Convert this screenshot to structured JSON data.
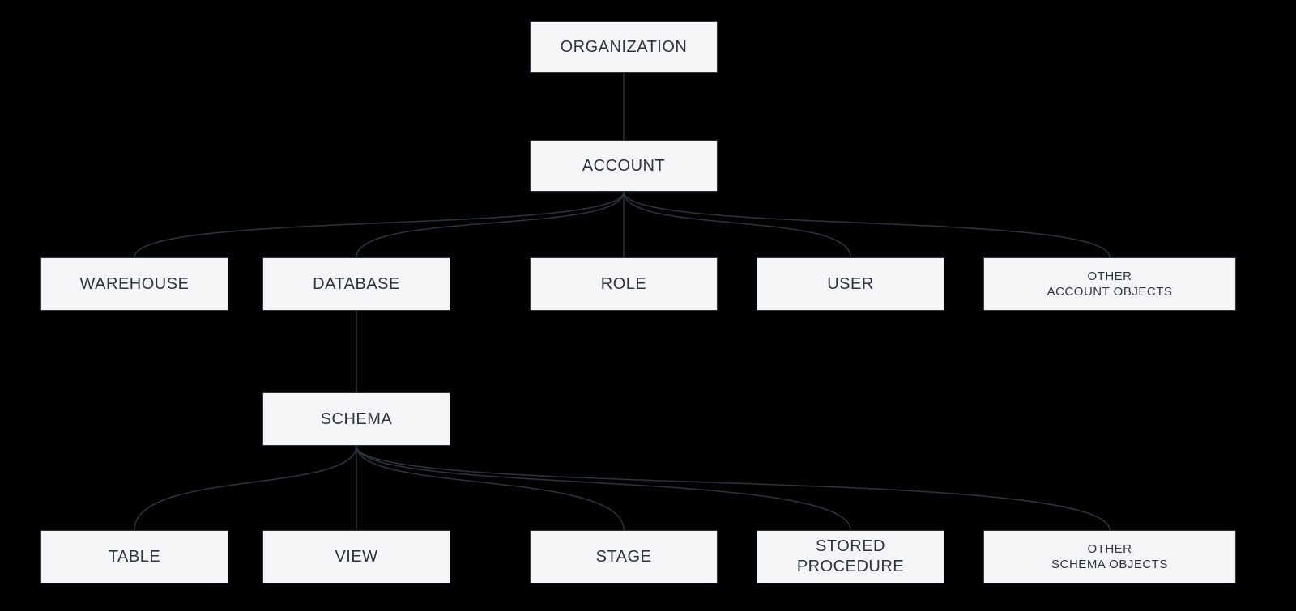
{
  "diagram": {
    "nodes": {
      "organization": {
        "label": "ORGANIZATION"
      },
      "account": {
        "label": "ACCOUNT"
      },
      "warehouse": {
        "label": "WAREHOUSE"
      },
      "database": {
        "label": "DATABASE"
      },
      "role": {
        "label": "ROLE"
      },
      "user": {
        "label": "USER"
      },
      "other_account": {
        "label": "OTHER\nACCOUNT OBJECTS"
      },
      "schema": {
        "label": "SCHEMA"
      },
      "table": {
        "label": "TABLE"
      },
      "view": {
        "label": "VIEW"
      },
      "stage": {
        "label": "STAGE"
      },
      "stored_procedure": {
        "label": "STORED\nPROCEDURE"
      },
      "other_schema": {
        "label": "OTHER\nSCHEMA OBJECTS"
      }
    },
    "edges": [
      {
        "from": "organization",
        "to": "account"
      },
      {
        "from": "account",
        "to": "warehouse"
      },
      {
        "from": "account",
        "to": "database"
      },
      {
        "from": "account",
        "to": "role"
      },
      {
        "from": "account",
        "to": "user"
      },
      {
        "from": "account",
        "to": "other_account"
      },
      {
        "from": "database",
        "to": "schema"
      },
      {
        "from": "schema",
        "to": "table"
      },
      {
        "from": "schema",
        "to": "view"
      },
      {
        "from": "schema",
        "to": "stage"
      },
      {
        "from": "schema",
        "to": "stored_procedure"
      },
      {
        "from": "schema",
        "to": "other_schema"
      }
    ]
  },
  "colors": {
    "background": "#000000",
    "node_fill": "#f4f5f7",
    "node_border": "#2c3440",
    "text": "#2c3440",
    "connector": "#2c3440"
  }
}
